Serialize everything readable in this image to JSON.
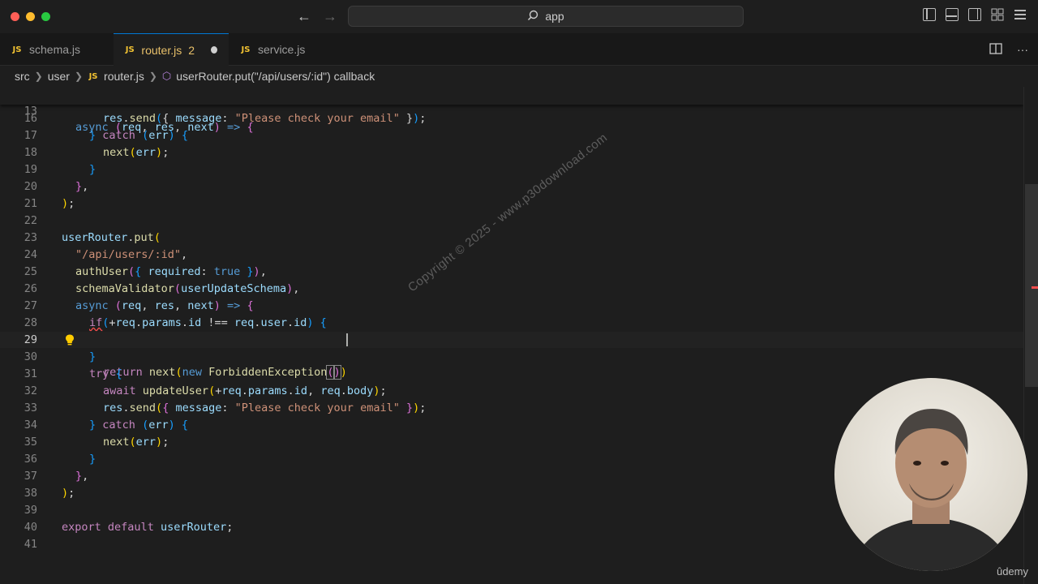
{
  "window": {
    "search_label": "app"
  },
  "tabs": [
    {
      "label": "schema.js",
      "badge": ""
    },
    {
      "label": "router.js",
      "badge": "2"
    },
    {
      "label": "service.js",
      "badge": ""
    }
  ],
  "breadcrumb": [
    "src",
    "user",
    "router.js",
    "userRouter.put(\"/api/users/:id\") callback"
  ],
  "editor": {
    "sticky_line": "13",
    "lines": [
      "16",
      "17",
      "18",
      "19",
      "20",
      "21",
      "22",
      "23",
      "24",
      "25",
      "26",
      "27",
      "28",
      "29",
      "30",
      "31",
      "32",
      "33",
      "34",
      "35",
      "36",
      "37",
      "38",
      "39",
      "40",
      "41"
    ],
    "current_line": "29"
  },
  "watermark": "Copyright © 2025 - www.p30download.com",
  "logo": "ûdemy",
  "colors": {
    "accent": "#0078d4",
    "js_icon": "#f1c232",
    "error": "#f14c4c"
  }
}
